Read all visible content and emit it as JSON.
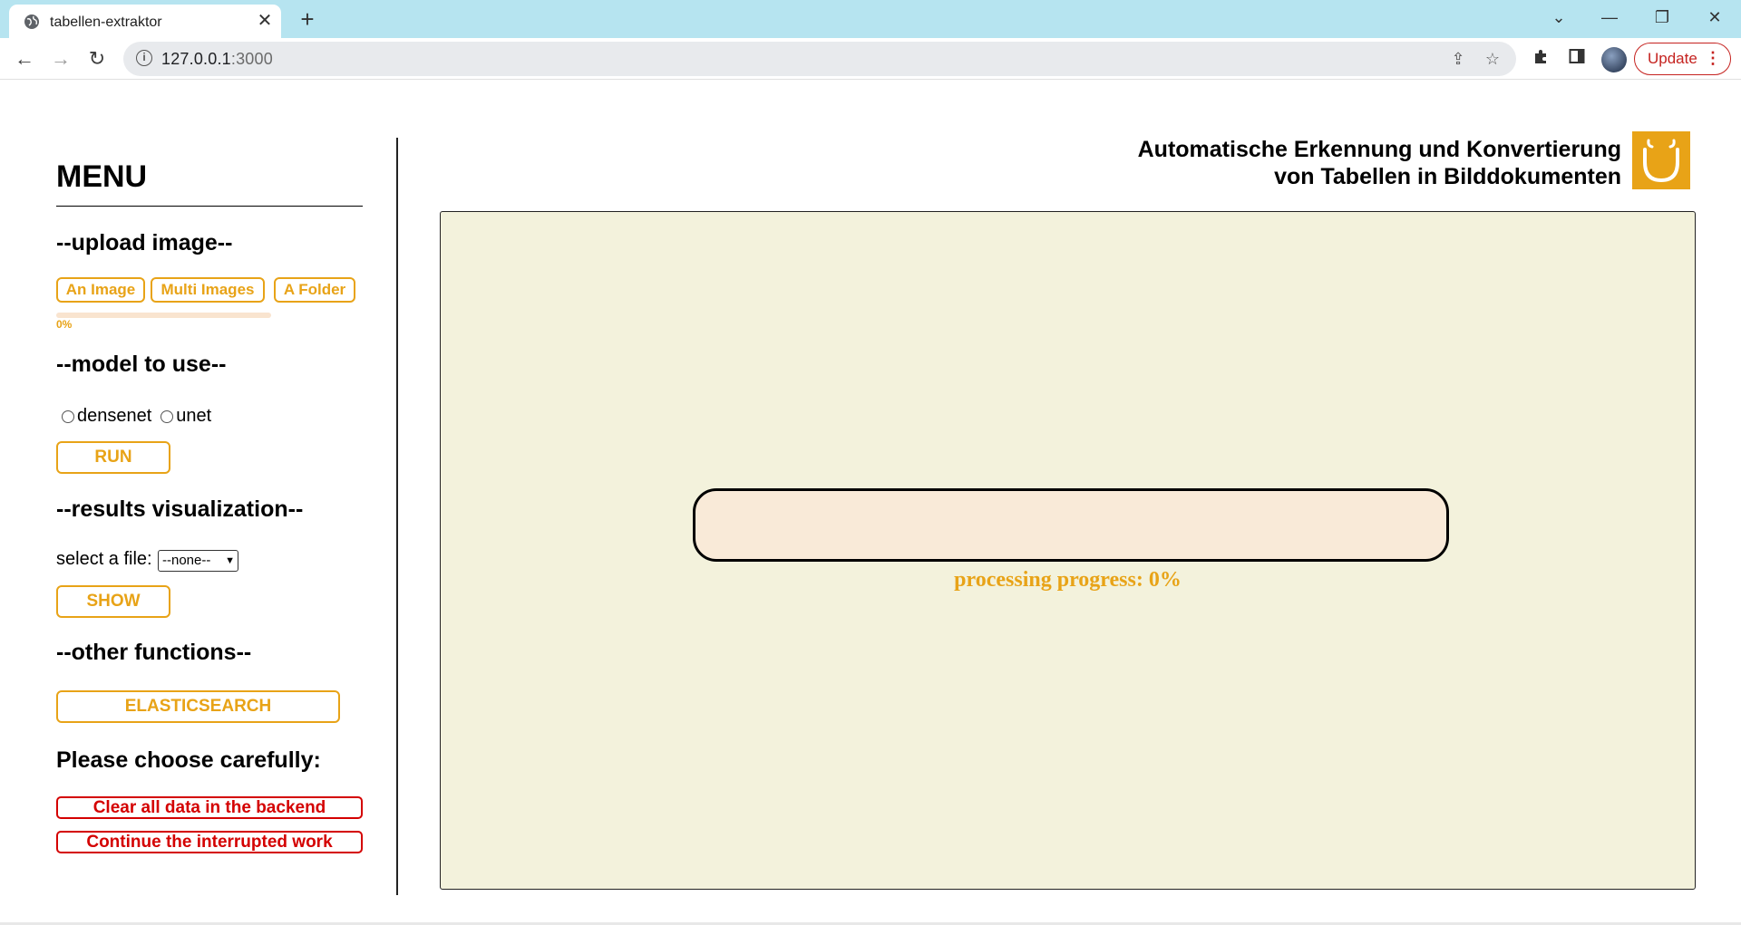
{
  "browser": {
    "tab_title": "tabellen-extraktor",
    "url_host": "127.0.0.1",
    "url_port": ":3000",
    "update_label": "Update"
  },
  "menu": {
    "title": "MENU",
    "upload": {
      "heading": "--upload image--",
      "buttons": [
        "An Image",
        "Multi Images",
        "A Folder"
      ],
      "progress_percent": 0,
      "progress_label": "0%"
    },
    "model": {
      "heading": "--model to use--",
      "options": [
        "densenet",
        "unet"
      ],
      "run_label": "RUN"
    },
    "results": {
      "heading": "--results visualization--",
      "select_label": "select a file:",
      "select_value": "--none--",
      "show_label": "SHOW"
    },
    "other": {
      "heading": "--other functions--",
      "elasticsearch_label": "ELASTICSEARCH"
    },
    "danger": {
      "heading": "Please choose carefully:",
      "clear_label": "Clear all data in the backend",
      "continue_label": "Continue the interrupted work"
    }
  },
  "header": {
    "title_line1": "Automatische Erkennung und Konvertierung",
    "title_line2": "von Tabellen in Bilddokumenten"
  },
  "main": {
    "progress_percent": 0,
    "progress_label": "processing progress: 0%"
  },
  "colors": {
    "accent": "#e8a317",
    "danger": "#d40000",
    "canvas_bg": "#f3f2dc",
    "tabbar": "#b6e4f0"
  }
}
